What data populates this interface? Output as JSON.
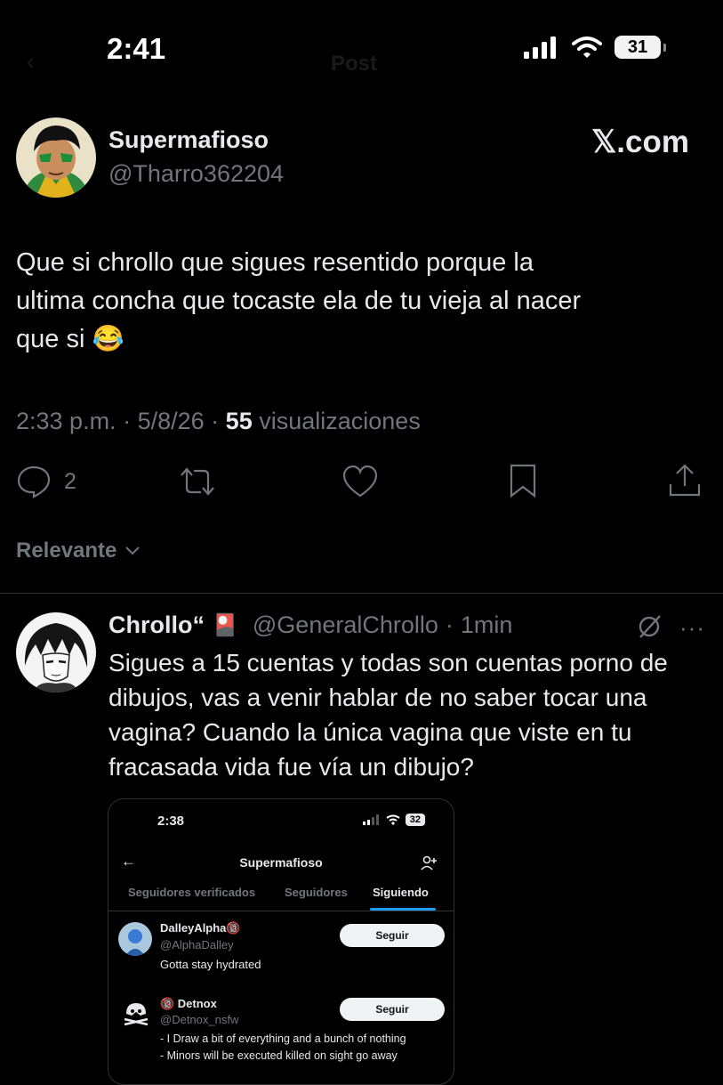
{
  "status_bar": {
    "time": "2:41",
    "battery": "31"
  },
  "header_ghost": "Post",
  "post": {
    "display_name": "Supermafioso",
    "handle": "@Tharro362204",
    "site_logo": "𝕏.com",
    "text_line1": "Que si chrollo que sigues resentido porque la",
    "text_line2": "ultima concha que tocaste ela de tu vieja al nacer",
    "text_line3": "que si 😂",
    "time": "2:33 p.m.",
    "date": "5/8/26",
    "views_count": "55",
    "views_label": "visualizaciones",
    "reply_count": "2"
  },
  "sort": {
    "label": "Relevante"
  },
  "reply": {
    "display_name": "Chrollo“",
    "emoji": "🎴",
    "handle": "@GeneralChrollo",
    "age": "1min",
    "text_line1": "Sigues a 15 cuentas y todas son cuentas porno de",
    "text_line2": "dibujos, vas a venir hablar de no saber tocar una",
    "text_line3": "vagina? Cuando la única vagina que viste en tu",
    "text_line4": "fracasada vida fue vía un dibujo?"
  },
  "embedded_screenshot": {
    "time": "2:38",
    "battery": "32",
    "title": "Supermafioso",
    "tabs": [
      "Seguidores verificados",
      "Seguidores",
      "Siguiendo"
    ],
    "accounts": [
      {
        "name": "DalleyAlpha🔞",
        "handle": "@AlphaDalley",
        "bio": "Gotta stay hydrated",
        "button": "Seguir"
      },
      {
        "name": "🔞 Detnox",
        "handle": "@Detnox_nsfw",
        "bio1": "- I Draw a bit of everything and a bunch of nothing",
        "bio2": "- Minors will be executed killed on sight go away",
        "button": "Seguir"
      }
    ]
  }
}
